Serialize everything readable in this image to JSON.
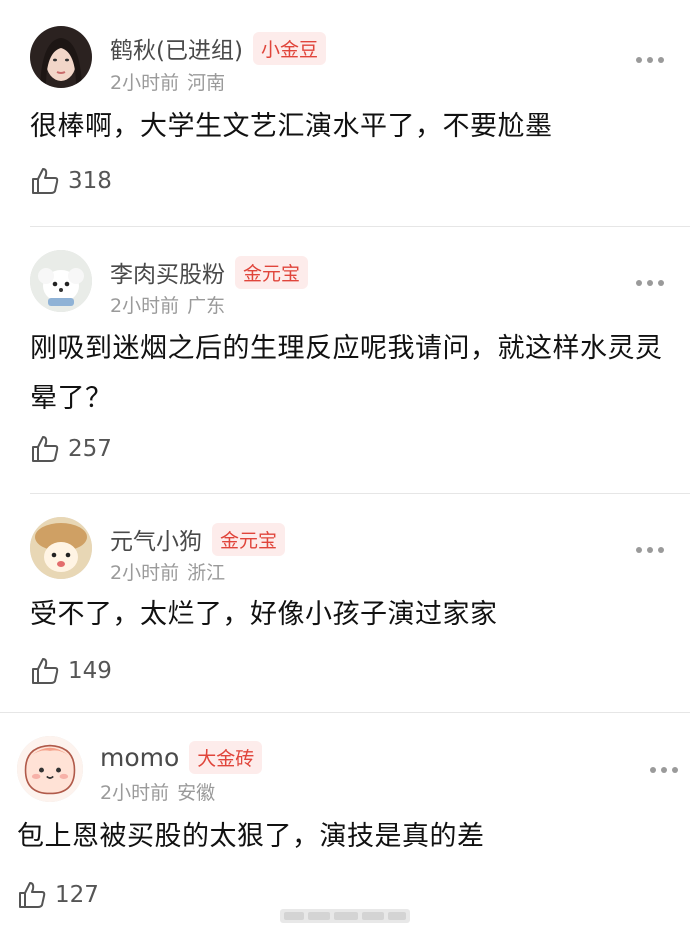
{
  "comments": [
    {
      "username": "鹤秋(已进组)",
      "badge": "小金豆",
      "time": "2小时前",
      "location": "河南",
      "text": "很棒啊，大学生文艺汇演水平了，不要尬墨",
      "likes": "318",
      "avatar": "woman-portrait"
    },
    {
      "username": "李肉买股粉",
      "badge": "金元宝",
      "time": "2小时前",
      "location": "广东",
      "text": "刚吸到迷烟之后的生理反应呢我请问，就这样水灵灵晕了？",
      "likes": "257",
      "avatar": "white-dog"
    },
    {
      "username": "元气小狗",
      "badge": "金元宝",
      "time": "2小时前",
      "location": "浙江",
      "text": "受不了，太烂了，好像小孩子演过家家",
      "likes": "149",
      "avatar": "puppy-in-hat"
    },
    {
      "username": "momo",
      "badge": "大金砖",
      "time": "2小时前",
      "location": "安徽",
      "text": "包上恩被买股的太狠了，演技是真的差",
      "likes": "127",
      "avatar": "cartoon-peach"
    }
  ],
  "icons": {
    "like": "thumbs-up-icon",
    "more": "more-dots-icon"
  },
  "colors": {
    "badge_text": "#e0453b",
    "badge_bg": "#fdeceb",
    "meta": "#9a9a9a"
  }
}
